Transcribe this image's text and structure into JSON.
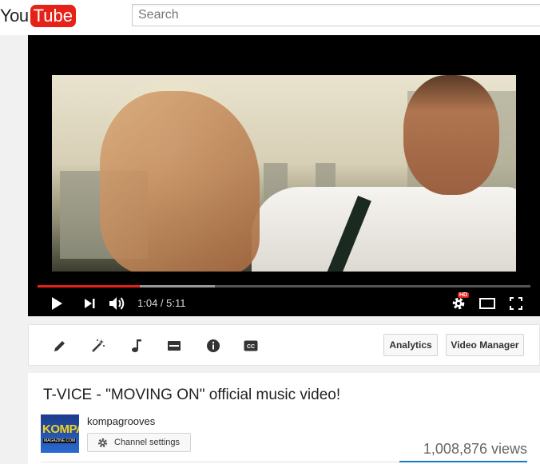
{
  "header": {
    "logo_you": "You",
    "logo_tube": "Tube",
    "search_placeholder": "Search"
  },
  "player": {
    "time": "1:04 / 5:11",
    "progress_played_fraction": 0.207,
    "progress_buffered_fraction": 0.36,
    "quality_badge": "HD",
    "icons": [
      "play-icon",
      "next-icon",
      "volume-icon",
      "settings-icon",
      "theater-mode-icon",
      "fullscreen-icon"
    ]
  },
  "editor": {
    "tools": [
      "pencil-icon",
      "magic-wand-icon",
      "music-note-icon",
      "card-icon",
      "info-icon",
      "cc-icon"
    ],
    "analytics_label": "Analytics",
    "video_manager_label": "Video Manager",
    "cc_text": "CC"
  },
  "video": {
    "title": "T-VICE - \"MOVING ON\" official music video!",
    "channel_name": "kompagrooves",
    "avatar_text": "KOMPA",
    "avatar_subtext": "MAGAZINE.COM",
    "channel_settings_label": "Channel settings",
    "views": "1,008,876 views"
  },
  "colors": {
    "brand_red": "#e62117",
    "link_blue": "#167ac6"
  }
}
